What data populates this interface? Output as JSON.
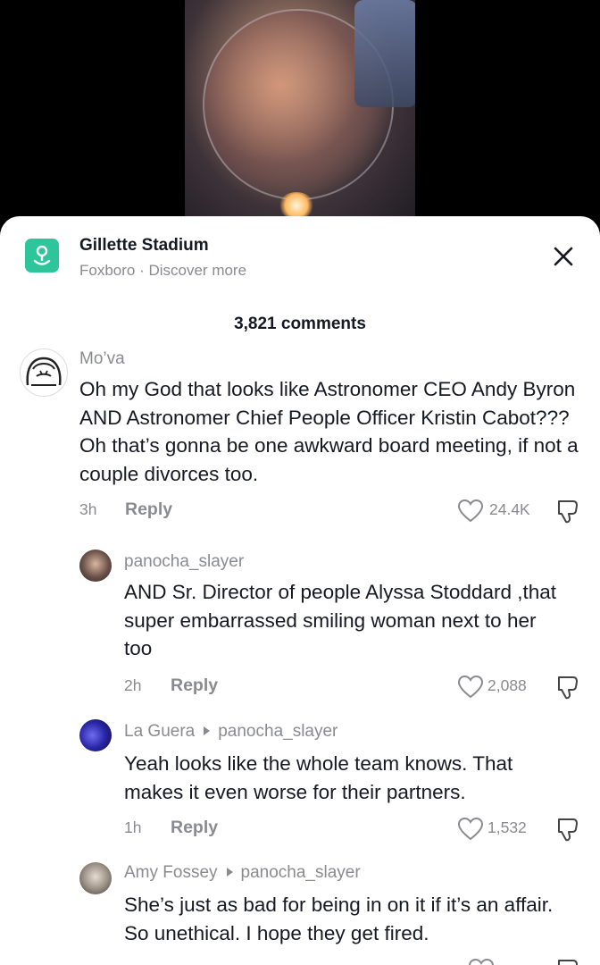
{
  "location": {
    "name": "Gillette Stadium",
    "subtitle": "Foxboro · Discover more"
  },
  "comments_header": "3,821 comments",
  "colors": {
    "accent": "#2fc59b",
    "text": "#161823",
    "muted": "#8a8b91"
  },
  "comments": [
    {
      "username": "Mo’va",
      "reply_to": null,
      "text": "Oh my God that looks like Astronomer CEO Andy Byron AND Astronomer Chief People Officer Kristin Cabot??? Oh that’s gonna be one awkward board meeting, if not a couple divorces too.",
      "time": "3h",
      "reply_label": "Reply",
      "likes": "24.4K"
    },
    {
      "username": "panocha_slayer",
      "reply_to": null,
      "text": "AND Sr. Director of people Alyssa Stoddard ,that super embarrassed smiling woman next to her too",
      "time": "2h",
      "reply_label": "Reply",
      "likes": "2,088"
    },
    {
      "username": "La Guera",
      "reply_to": "panocha_slayer",
      "text": "Yeah looks like the whole team knows. That makes it even worse for their partners.",
      "time": "1h",
      "reply_label": "Reply",
      "likes": "1,532"
    },
    {
      "username": "Amy Fossey",
      "reply_to": "panocha_slayer",
      "text": "She’s just as bad for being in on it if it’s an affair. So unethical. I hope they get fired.",
      "time": "",
      "reply_label": "",
      "likes": ""
    }
  ]
}
